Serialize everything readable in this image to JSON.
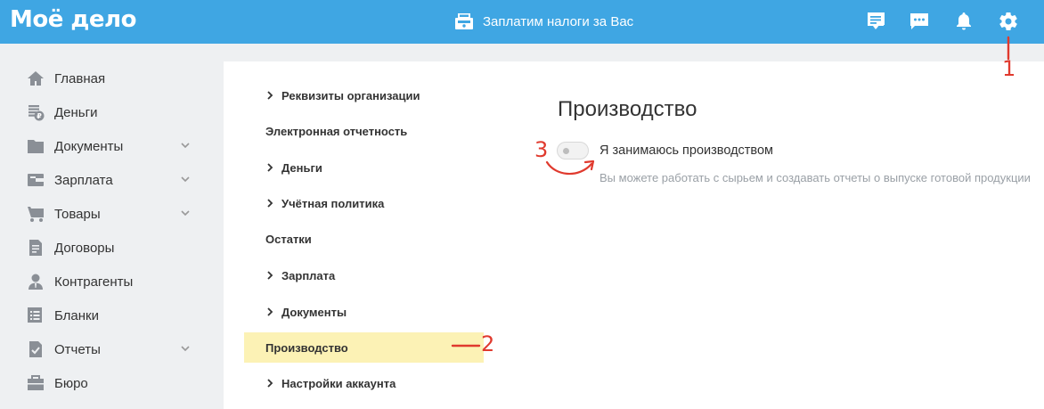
{
  "header": {
    "logo": "Моё дело",
    "promo_text": "Заплатим налоги за Вас",
    "icons": [
      "cashier-icon",
      "notes-icon",
      "chat-icon",
      "bell-icon",
      "gear-icon"
    ],
    "color": "#3fa6e3"
  },
  "sidebar": {
    "items": [
      {
        "label": "Главная",
        "icon": "home-icon",
        "has_submenu": false
      },
      {
        "label": "Деньги",
        "icon": "money-icon",
        "has_submenu": false
      },
      {
        "label": "Документы",
        "icon": "folder-icon",
        "has_submenu": true
      },
      {
        "label": "Зарплата",
        "icon": "wallet-icon",
        "has_submenu": true
      },
      {
        "label": "Товары",
        "icon": "cart-icon",
        "has_submenu": true
      },
      {
        "label": "Договоры",
        "icon": "contract-icon",
        "has_submenu": false
      },
      {
        "label": "Контрагенты",
        "icon": "person-icon",
        "has_submenu": false
      },
      {
        "label": "Бланки",
        "icon": "forms-icon",
        "has_submenu": false
      },
      {
        "label": "Отчеты",
        "icon": "report-icon",
        "has_submenu": true
      },
      {
        "label": "Бюро",
        "icon": "briefcase-icon",
        "has_submenu": false
      }
    ]
  },
  "settings_menu": {
    "items": [
      {
        "label": "Реквизиты организации",
        "expandable": true
      },
      {
        "label": "Электронная отчетность",
        "expandable": false
      },
      {
        "label": "Деньги",
        "expandable": true
      },
      {
        "label": "Учётная политика",
        "expandable": true
      },
      {
        "label": "Остатки",
        "expandable": false
      },
      {
        "label": "Зарплата",
        "expandable": true
      },
      {
        "label": "Документы",
        "expandable": true
      },
      {
        "label": "Производство",
        "expandable": false,
        "active": true
      },
      {
        "label": "Настройки аккаунта",
        "expandable": true
      }
    ],
    "active_color": "#fcf2b5"
  },
  "content": {
    "title": "Производство",
    "toggle_label": "Я занимаюсь производством",
    "toggle_on": false,
    "hint": "Вы можете работать с сырьем и создавать отчеты о выпуске готовой продукции"
  },
  "annotations": {
    "marker_1": "1",
    "marker_2": "2",
    "marker_3": "3",
    "color": "#e03a2e"
  }
}
